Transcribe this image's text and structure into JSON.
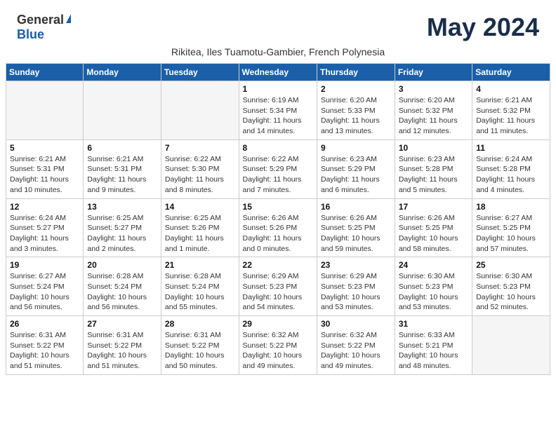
{
  "header": {
    "logo_general": "General",
    "logo_blue": "Blue",
    "month_title": "May 2024",
    "subtitle": "Rikitea, Iles Tuamotu-Gambier, French Polynesia"
  },
  "weekdays": [
    "Sunday",
    "Monday",
    "Tuesday",
    "Wednesday",
    "Thursday",
    "Friday",
    "Saturday"
  ],
  "weeks": [
    [
      {
        "day": "",
        "info": ""
      },
      {
        "day": "",
        "info": ""
      },
      {
        "day": "",
        "info": ""
      },
      {
        "day": "1",
        "info": "Sunrise: 6:19 AM\nSunset: 5:34 PM\nDaylight: 11 hours and 14 minutes."
      },
      {
        "day": "2",
        "info": "Sunrise: 6:20 AM\nSunset: 5:33 PM\nDaylight: 11 hours and 13 minutes."
      },
      {
        "day": "3",
        "info": "Sunrise: 6:20 AM\nSunset: 5:32 PM\nDaylight: 11 hours and 12 minutes."
      },
      {
        "day": "4",
        "info": "Sunrise: 6:21 AM\nSunset: 5:32 PM\nDaylight: 11 hours and 11 minutes."
      }
    ],
    [
      {
        "day": "5",
        "info": "Sunrise: 6:21 AM\nSunset: 5:31 PM\nDaylight: 11 hours and 10 minutes."
      },
      {
        "day": "6",
        "info": "Sunrise: 6:21 AM\nSunset: 5:31 PM\nDaylight: 11 hours and 9 minutes."
      },
      {
        "day": "7",
        "info": "Sunrise: 6:22 AM\nSunset: 5:30 PM\nDaylight: 11 hours and 8 minutes."
      },
      {
        "day": "8",
        "info": "Sunrise: 6:22 AM\nSunset: 5:29 PM\nDaylight: 11 hours and 7 minutes."
      },
      {
        "day": "9",
        "info": "Sunrise: 6:23 AM\nSunset: 5:29 PM\nDaylight: 11 hours and 6 minutes."
      },
      {
        "day": "10",
        "info": "Sunrise: 6:23 AM\nSunset: 5:28 PM\nDaylight: 11 hours and 5 minutes."
      },
      {
        "day": "11",
        "info": "Sunrise: 6:24 AM\nSunset: 5:28 PM\nDaylight: 11 hours and 4 minutes."
      }
    ],
    [
      {
        "day": "12",
        "info": "Sunrise: 6:24 AM\nSunset: 5:27 PM\nDaylight: 11 hours and 3 minutes."
      },
      {
        "day": "13",
        "info": "Sunrise: 6:25 AM\nSunset: 5:27 PM\nDaylight: 11 hours and 2 minutes."
      },
      {
        "day": "14",
        "info": "Sunrise: 6:25 AM\nSunset: 5:26 PM\nDaylight: 11 hours and 1 minute."
      },
      {
        "day": "15",
        "info": "Sunrise: 6:26 AM\nSunset: 5:26 PM\nDaylight: 11 hours and 0 minutes."
      },
      {
        "day": "16",
        "info": "Sunrise: 6:26 AM\nSunset: 5:25 PM\nDaylight: 10 hours and 59 minutes."
      },
      {
        "day": "17",
        "info": "Sunrise: 6:26 AM\nSunset: 5:25 PM\nDaylight: 10 hours and 58 minutes."
      },
      {
        "day": "18",
        "info": "Sunrise: 6:27 AM\nSunset: 5:25 PM\nDaylight: 10 hours and 57 minutes."
      }
    ],
    [
      {
        "day": "19",
        "info": "Sunrise: 6:27 AM\nSunset: 5:24 PM\nDaylight: 10 hours and 56 minutes."
      },
      {
        "day": "20",
        "info": "Sunrise: 6:28 AM\nSunset: 5:24 PM\nDaylight: 10 hours and 56 minutes."
      },
      {
        "day": "21",
        "info": "Sunrise: 6:28 AM\nSunset: 5:24 PM\nDaylight: 10 hours and 55 minutes."
      },
      {
        "day": "22",
        "info": "Sunrise: 6:29 AM\nSunset: 5:23 PM\nDaylight: 10 hours and 54 minutes."
      },
      {
        "day": "23",
        "info": "Sunrise: 6:29 AM\nSunset: 5:23 PM\nDaylight: 10 hours and 53 minutes."
      },
      {
        "day": "24",
        "info": "Sunrise: 6:30 AM\nSunset: 5:23 PM\nDaylight: 10 hours and 53 minutes."
      },
      {
        "day": "25",
        "info": "Sunrise: 6:30 AM\nSunset: 5:23 PM\nDaylight: 10 hours and 52 minutes."
      }
    ],
    [
      {
        "day": "26",
        "info": "Sunrise: 6:31 AM\nSunset: 5:22 PM\nDaylight: 10 hours and 51 minutes."
      },
      {
        "day": "27",
        "info": "Sunrise: 6:31 AM\nSunset: 5:22 PM\nDaylight: 10 hours and 51 minutes."
      },
      {
        "day": "28",
        "info": "Sunrise: 6:31 AM\nSunset: 5:22 PM\nDaylight: 10 hours and 50 minutes."
      },
      {
        "day": "29",
        "info": "Sunrise: 6:32 AM\nSunset: 5:22 PM\nDaylight: 10 hours and 49 minutes."
      },
      {
        "day": "30",
        "info": "Sunrise: 6:32 AM\nSunset: 5:22 PM\nDaylight: 10 hours and 49 minutes."
      },
      {
        "day": "31",
        "info": "Sunrise: 6:33 AM\nSunset: 5:21 PM\nDaylight: 10 hours and 48 minutes."
      },
      {
        "day": "",
        "info": ""
      }
    ]
  ]
}
